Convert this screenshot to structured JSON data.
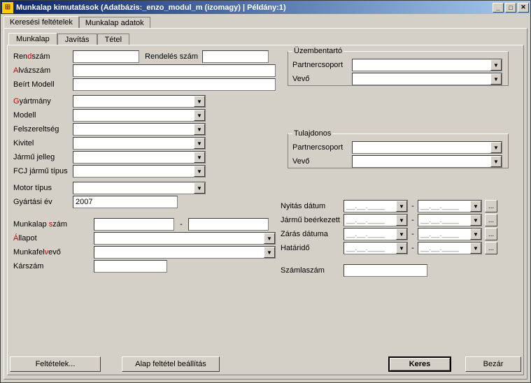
{
  "title": "Munkalap kimutatások   (Adatbázis:_enzo_modul_m (izomagy) | Példány:1)",
  "outer_tabs": [
    "Keresési feltételek",
    "Munkalap adatok"
  ],
  "inner_tabs": [
    "Munkalap",
    "Javítás",
    "Tétel"
  ],
  "labels": {
    "rendszam_pre": "Ren",
    "rendszam_hot": "d",
    "rendszam_post": "szám",
    "rendelesszam": "Rendelés szám",
    "alvazszam_hot": "A",
    "alvazszam_post": "lvázszám",
    "beirtmodell": "Beírt Modell",
    "gyartmany_hot": "G",
    "gyartmany_post": "yártmány",
    "modell": "Modell",
    "felszereltseg": "Felszereltség",
    "kivitel": "Kivitel",
    "jarmujelleg": "Jármű jelleg",
    "fcj": "FCJ jármű típus",
    "motortipus": "Motor típus",
    "gyartasiev": "Gyártási év",
    "munkalapszam_pre": "Munkalap ",
    "munkalapszam_hot": "s",
    "munkalapszam_post": "zám",
    "allapot_hot": "Á",
    "allapot_post": "llapot",
    "munkafelvevo_pre": "Munkafel",
    "munkafelvevo_hot": "v",
    "munkafelvevo_post": "evő",
    "karszam": "Kárszám",
    "uzembentarto": "Üzembentartó",
    "partnercsoport": "Partnercsoport",
    "vevo": "Vevő",
    "tulajdonos": "Tulajdonos",
    "nyitasdatum": "Nyitás dátum",
    "jarmu_be": "Jármű beérkezett",
    "zarasdatuma": "Zárás dátuma",
    "hatarido": "Határidő",
    "szamlaszam": "Számlaszám",
    "dash": "-",
    "ellipsis": "...",
    "datemask": "__.__.____"
  },
  "values": {
    "gyartasiev": "2007"
  },
  "buttons": {
    "feltetelek": "Feltételek...",
    "alap": "Alap feltétel beállítás",
    "keres": "Keres",
    "bezar": "Bezár"
  }
}
